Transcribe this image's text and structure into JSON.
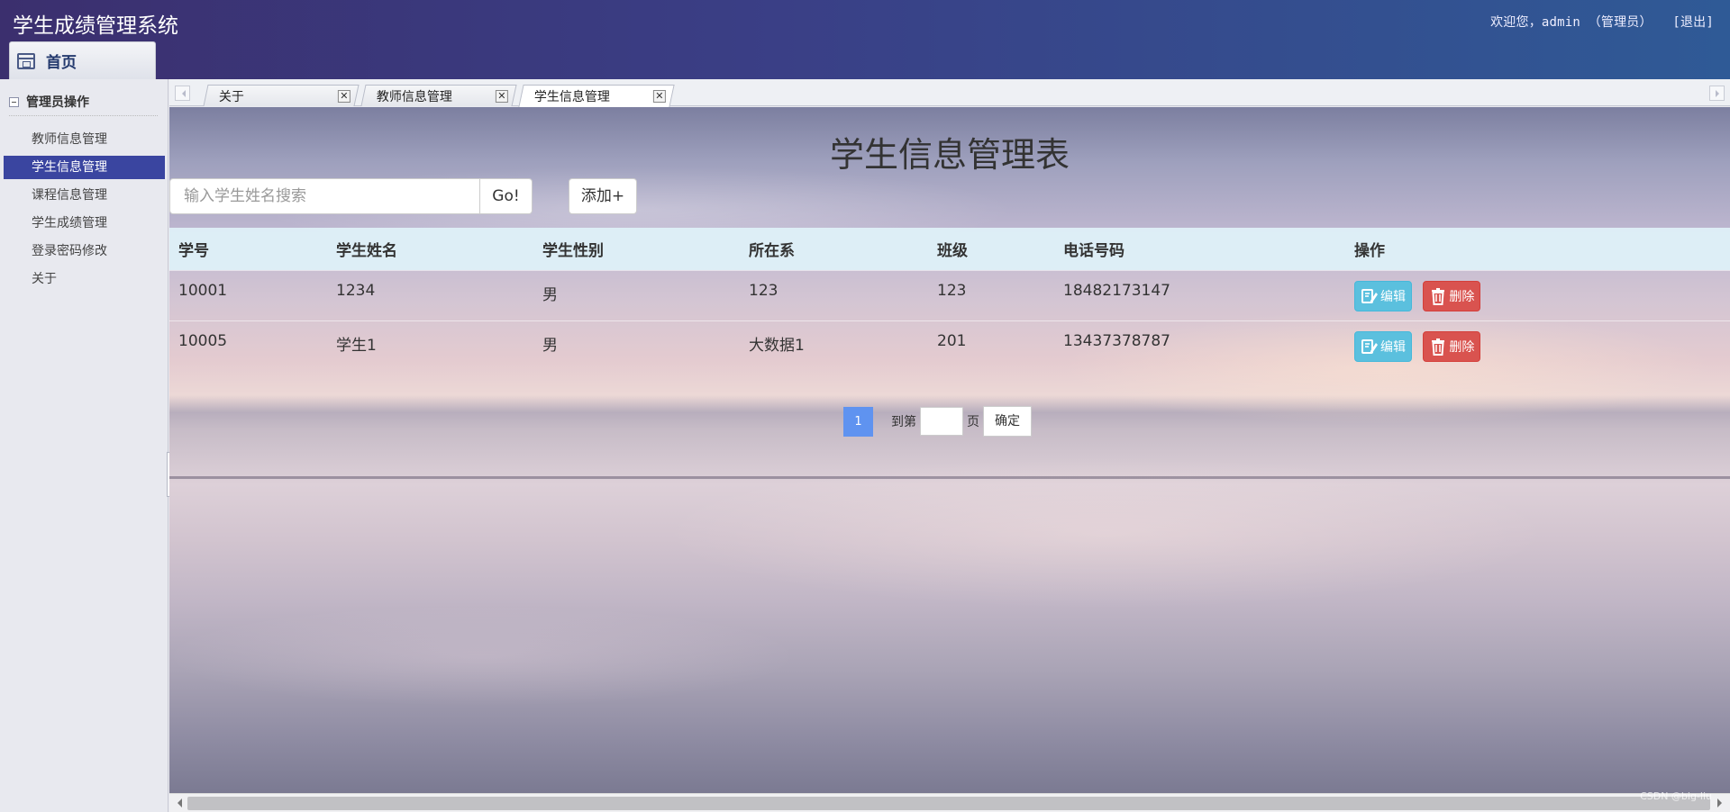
{
  "header": {
    "app_title": "学生成绩管理系统",
    "welcome": "欢迎您，admin （管理员）",
    "logout": "[退出]",
    "home_tab": "首页"
  },
  "sidebar": {
    "group": "管理员操作",
    "items": [
      {
        "label": "教师信息管理",
        "active": false
      },
      {
        "label": "学生信息管理",
        "active": true
      },
      {
        "label": "课程信息管理",
        "active": false
      },
      {
        "label": "学生成绩管理",
        "active": false
      },
      {
        "label": "登录密码修改",
        "active": false
      },
      {
        "label": "关于",
        "active": false
      }
    ]
  },
  "tabs": [
    {
      "label": "关于",
      "active": false
    },
    {
      "label": "教师信息管理",
      "active": false
    },
    {
      "label": "学生信息管理",
      "active": true
    }
  ],
  "page": {
    "title": "学生信息管理表",
    "search_placeholder": "输入学生姓名搜索",
    "go_label": "Go!",
    "add_label": "添加+"
  },
  "table": {
    "columns": [
      "学号",
      "学生姓名",
      "学生性别",
      "所在系",
      "班级",
      "电话号码",
      "操作"
    ],
    "rows": [
      {
        "id": "10001",
        "name": "1234",
        "gender": "男",
        "dept": "123",
        "class": "123",
        "phone": "18482173147"
      },
      {
        "id": "10005",
        "name": "学生1",
        "gender": "男",
        "dept": "大数据1",
        "class": "201",
        "phone": "13437378787"
      }
    ],
    "edit_label": "编辑",
    "delete_label": "删除"
  },
  "pager": {
    "current_page": "1",
    "goto_prefix": "到第",
    "goto_suffix": "页",
    "confirm": "确定"
  },
  "watermark": "CSDN @big-liu",
  "colors": {
    "header_start": "#3b2f6e",
    "header_end": "#2f5a96",
    "sidebar_active": "#3a45a0",
    "edit_button": "#5bc0de",
    "delete_button": "#d9534f",
    "page_active": "#5f93f0"
  }
}
